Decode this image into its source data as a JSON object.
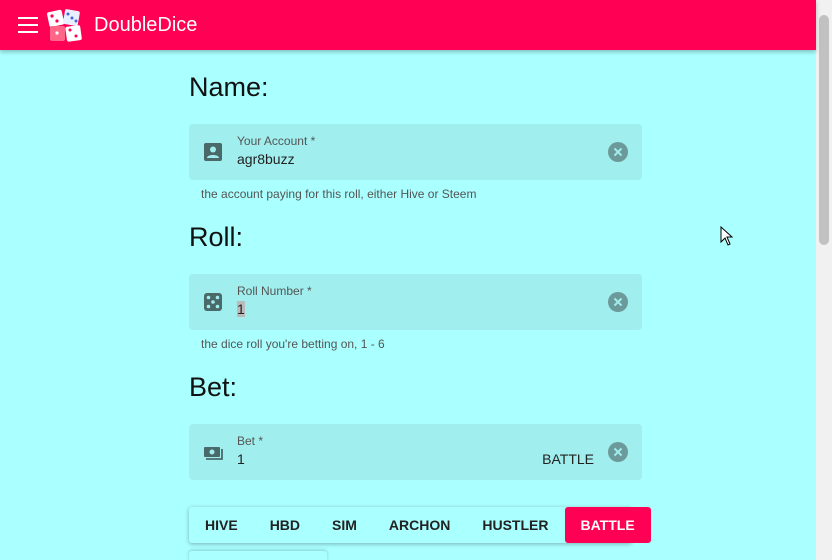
{
  "app": {
    "title": "DoubleDice"
  },
  "sections": {
    "name_heading": "Name:",
    "roll_heading": "Roll:",
    "bet_heading": "Bet:"
  },
  "account_field": {
    "label": "Your Account *",
    "value": "agr8buzz",
    "helper": "the account paying for this roll, either Hive or Steem",
    "icon": "account-box-icon"
  },
  "roll_field": {
    "label": "Roll Number *",
    "value": "1",
    "helper": "the dice roll you're betting on, 1 - 6",
    "icon": "dice-icon"
  },
  "bet_field": {
    "label": "Bet *",
    "value": "1",
    "suffix": "BATTLE",
    "icon": "cash-icon"
  },
  "tokens": {
    "items": [
      "HIVE",
      "HBD",
      "SIM",
      "ARCHON",
      "HUSTLER",
      "BATTLE"
    ],
    "selected": "BATTLE"
  },
  "colors": {
    "accent": "#ff0055",
    "background": "#aaffff",
    "field": "#a0eeee"
  }
}
